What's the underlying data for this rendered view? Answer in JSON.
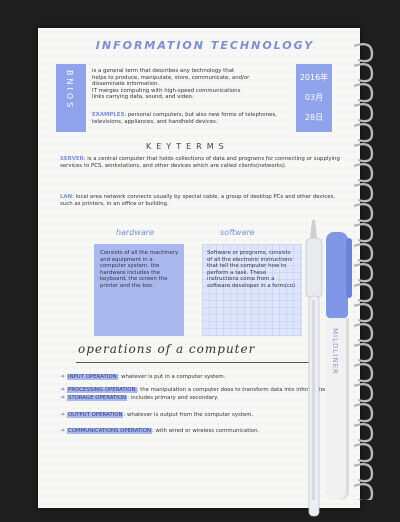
{
  "title": "INFORMATION TECHNOLOGY",
  "tab_left": "BNIOS",
  "tab_right": [
    "2016年",
    "03月",
    "28日"
  ],
  "intro": [
    "is a general term that describes any technology that",
    "helps to produce, manipulate, store, communicate, and/or",
    "disseminate information.",
    "IT merges computing with high-speed communications",
    "links carrying data, sound, and video."
  ],
  "examples_label": "EXAMPLES",
  "examples_text": ": personal computers, but also new forms of telephones, televisions, appliances, and handheld devices.",
  "keyterms": "KEYTERMS",
  "server_label": "SERVER",
  "server_text": ": is a central computer that holds collections of data and programs for connecting or supplying services to PCS, workstations, and other devices which are called clients(networks).",
  "lan_label": "LAN",
  "lan_text": ": local area network connects usually by special cable, a group of desktop PCs and other devices, such as printers, in an office or building.",
  "hardware_title": "hardware",
  "hardware_text": "Consists of all the machinery and equipment in a computer system. the hardware includes the keyboard, the screen the printer and the box.",
  "software_title": "software",
  "software_text": "Software or programs, consists of all the electronic instructions that tell the computer how to perform a task. These instructions come from a software developer in a form(co)",
  "ops_title": "operations of a computer",
  "ops": [
    {
      "label": "INPUT OPERATION",
      "text": ": whatever is put in a computer system."
    },
    {
      "label": "PROCESSING OPERATION",
      "text": ": the manipulation a computer does to transform data into information."
    },
    {
      "label": "STORAGE OPERATION",
      "text": ": includes primary and secondary."
    },
    {
      "label": "OUTPUT OPERATION",
      "text": ": whatever is output from the computer system."
    },
    {
      "label": "COMMUNICATIONS OPERATION",
      "text": ": with wired or wireless communication."
    }
  ],
  "marker_text": "MILDLINER",
  "colors": {
    "accent": "#8ea3ea",
    "page": "#f7f7f5",
    "desk": "#1e1e1f"
  }
}
